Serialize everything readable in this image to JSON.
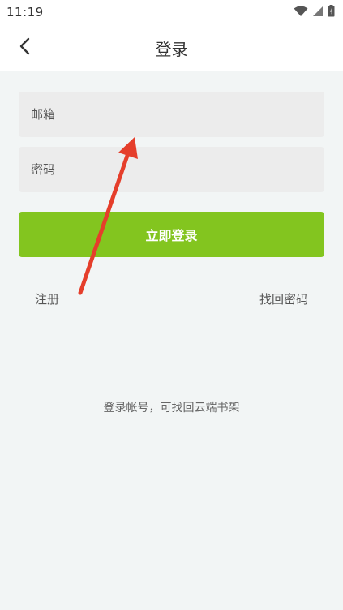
{
  "status_bar": {
    "time": "11:19",
    "icons": [
      "wifi-icon",
      "signal-icon",
      "battery-icon"
    ]
  },
  "nav": {
    "title": "登录",
    "back_icon": "chevron-left-icon"
  },
  "form": {
    "email_placeholder": "邮箱",
    "password_placeholder": "密码",
    "login_button": "立即登录",
    "register_link": "注册",
    "forgot_link": "找回密码"
  },
  "hint": "登录帐号，可找回云端书架",
  "colors": {
    "accent": "#83c51f",
    "annotation_arrow": "#e53e2b",
    "background": "#f2f5f5",
    "field_bg": "#ececec"
  }
}
